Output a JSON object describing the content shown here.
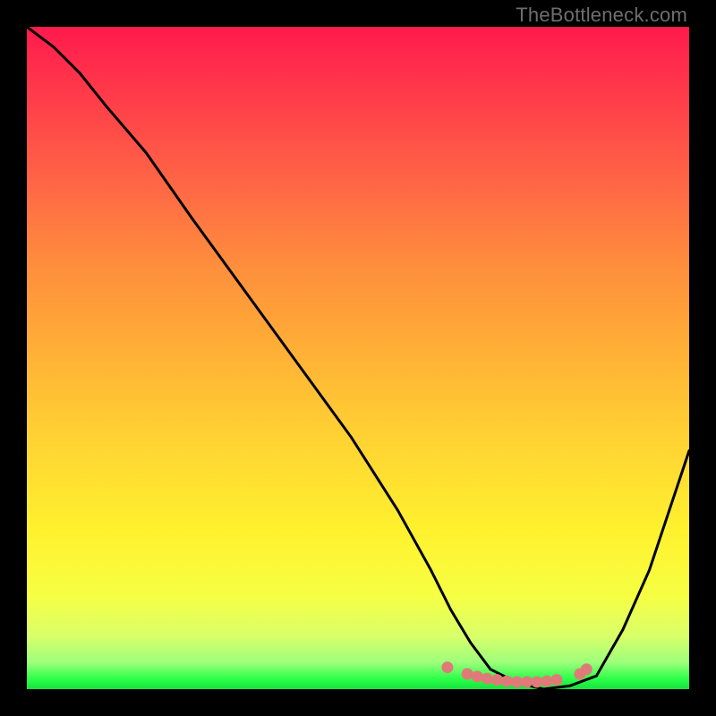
{
  "watermark": "TheBottleneck.com",
  "chart_data": {
    "type": "line",
    "title": "",
    "xlabel": "",
    "ylabel": "",
    "xlim": [
      0,
      100
    ],
    "ylim": [
      0,
      100
    ],
    "series": [
      {
        "name": "bottleneck-curve",
        "x": [
          0,
          4,
          8,
          12,
          18,
          25,
          33,
          41,
          49,
          56,
          61,
          64,
          67,
          70,
          74,
          78,
          82,
          86,
          90,
          94,
          97,
          100
        ],
        "y": [
          100,
          97,
          93,
          88,
          81,
          71,
          60,
          49,
          38,
          27,
          18,
          12,
          7,
          3,
          1,
          0,
          0.5,
          2,
          9,
          18,
          27,
          36
        ]
      }
    ],
    "markers": {
      "name": "valley-dots",
      "color": "#e07a78",
      "points": [
        {
          "x": 63.5,
          "y": 3.3
        },
        {
          "x": 66.5,
          "y": 2.3
        },
        {
          "x": 68.0,
          "y": 1.9
        },
        {
          "x": 69.5,
          "y": 1.6
        },
        {
          "x": 71.0,
          "y": 1.4
        },
        {
          "x": 72.5,
          "y": 1.2
        },
        {
          "x": 74.0,
          "y": 1.1
        },
        {
          "x": 75.5,
          "y": 1.1
        },
        {
          "x": 77.0,
          "y": 1.1
        },
        {
          "x": 78.5,
          "y": 1.2
        },
        {
          "x": 80.0,
          "y": 1.4
        },
        {
          "x": 83.5,
          "y": 2.3
        },
        {
          "x": 84.5,
          "y": 3.0
        }
      ]
    }
  }
}
